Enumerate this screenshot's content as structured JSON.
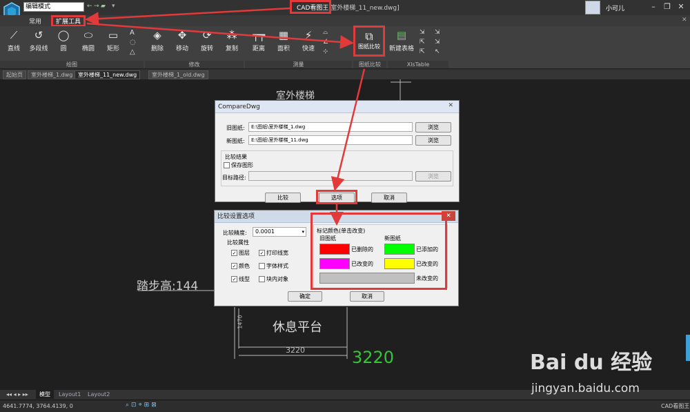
{
  "window": {
    "mode": "编辑模式",
    "app_title": "CAD看图王",
    "file_title": "室外楼梯_11_new.dwg]",
    "user": "小可儿"
  },
  "menu": {
    "tab_common": "常用",
    "tab_ext": "扩展工具"
  },
  "ribbon": {
    "tools": [
      "直线",
      "多段线",
      "圆",
      "椭圆",
      "矩形",
      "删除",
      "移动",
      "旋转",
      "复制",
      "距离",
      "面积",
      "快速",
      "图纸比较",
      "新建表格"
    ],
    "groups": [
      "绘图",
      "修改",
      "测量",
      "图纸比较",
      "XlsTable"
    ]
  },
  "doc_tabs": [
    "起始页",
    "室外楼梯_1.dwg",
    "室外楼梯_11_new.dwg",
    "室外楼梯_1_old.dwg"
  ],
  "canvas": {
    "title_text": "室外楼梯",
    "step_text": "踏步高:144",
    "platform_text": "休息平台",
    "dim_small": "3220",
    "dim_green": "3220",
    "dim_vertical": "1470"
  },
  "compare_dialog": {
    "title": "CompareDwg",
    "old_label": "旧图纸",
    "old_path": "E:\\图纸\\室外楼梯_1.dwg",
    "new_label": "新图纸",
    "new_path": "E:\\图纸\\室外楼梯_11.dwg",
    "browse": "浏览",
    "result_group": "比较结果",
    "save_shape": "保存图形",
    "target_path_label": "目标路径:",
    "compare_btn": "比较",
    "options_btn": "选项",
    "cancel_btn": "取消"
  },
  "settings_dialog": {
    "title": "比较设置选项",
    "precision_label": "比较精度:",
    "precision_value": "0.0001",
    "attr_group": "比较属性",
    "attrs": [
      {
        "label": "图层",
        "checked": true
      },
      {
        "label": "打印线宽",
        "checked": true
      },
      {
        "label": "颜色",
        "checked": true
      },
      {
        "label": "字体样式",
        "checked": false
      },
      {
        "label": "线型",
        "checked": true
      },
      {
        "label": "块内对象",
        "checked": false
      }
    ],
    "color_group": "标记颜色(单击改变)",
    "old_col": "旧图纸",
    "new_col": "新图纸",
    "colors": [
      {
        "label": "已删除的",
        "color": "#ff0000"
      },
      {
        "label": "已添加的",
        "color": "#00ff00"
      },
      {
        "label": "已改变的",
        "color": "#ff00ff"
      },
      {
        "label": "已改变的",
        "color": "#ffff00"
      },
      {
        "label": "未改变的",
        "color": "#c0c0c0"
      }
    ],
    "ok_btn": "确定",
    "cancel_btn": "取消"
  },
  "layout_tabs": [
    "模型",
    "Layout1",
    "Layout2"
  ],
  "status": {
    "coords": "4641.7774, 3764.4139, 0",
    "app": "CAD看图王"
  },
  "watermark": {
    "brand": "Bai du 经验",
    "url": "jingyan.baidu.com"
  }
}
